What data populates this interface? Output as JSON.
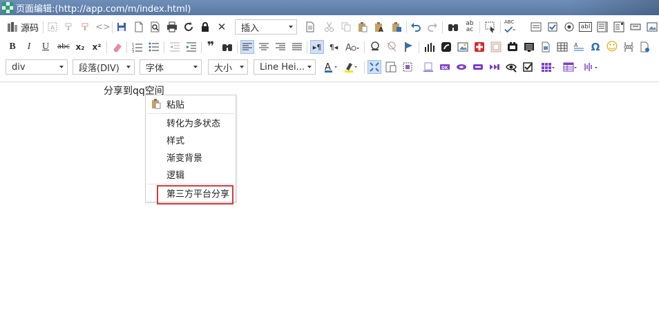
{
  "window": {
    "title": "页面编辑:(http://app.com/m/index.html)"
  },
  "toolbar": {
    "source_label": "源码",
    "insert_combo": "插入",
    "element_combo": "div",
    "paragraph_combo": "段落(DIV)",
    "font_combo": "字体",
    "size_combo": "大小",
    "lineheight_combo": "Line Hei...",
    "subscript": "x₂",
    "superscript": "x²",
    "abc_label": "ABC",
    "ab_label": "ab",
    "ac_label": "ac",
    "abl_label": "abl",
    "dk_label": "DK",
    "quote_glyph": "❞",
    "omega_glyph": "Ω",
    "smile_glyph": "☺",
    "accent_red": "#d63a3a",
    "accent_blue": "#2e6fb8"
  },
  "editor": {
    "content": "分享到qq空间"
  },
  "context_menu": {
    "items": [
      {
        "label": "粘贴",
        "icon": "paste-icon"
      },
      {
        "label": "转化为多状态"
      },
      {
        "label": "样式"
      },
      {
        "label": "渐变背景"
      },
      {
        "label": "逻辑"
      },
      {
        "label": "第三方平台分享",
        "highlighted": true
      }
    ]
  }
}
